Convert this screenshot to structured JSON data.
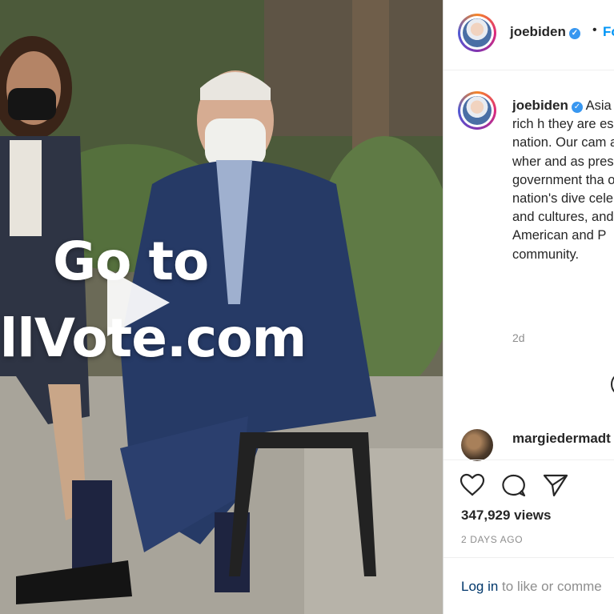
{
  "post": {
    "overlay_line1": "Go to",
    "overlay_line2": "illVote.com"
  },
  "header": {
    "username": "joebiden",
    "separator": "•",
    "follow_label": "Fo"
  },
  "caption": {
    "username": "joebiden",
    "text": "Asia deep and rich h they are essent nation. Our cam a coalition wher and as presiden government tha our nation's dive celebrating and cultures, and co American and P community.",
    "time": "2d"
  },
  "comment": {
    "username": "margiedermadt"
  },
  "stats": {
    "views": "347,929 views",
    "posted": "2 DAYS AGO"
  },
  "login": {
    "link_label": "Log in",
    "rest": " to like or comme"
  },
  "icons": {
    "verified": "verified-badge",
    "like": "heart-icon",
    "comment": "comment-icon",
    "share": "paper-plane-icon",
    "play": "play-icon",
    "more": "more-options-icon"
  },
  "colors": {
    "accent": "#0095f6",
    "verified": "#3897f0",
    "text": "#262626",
    "muted": "#8e8e8e"
  }
}
